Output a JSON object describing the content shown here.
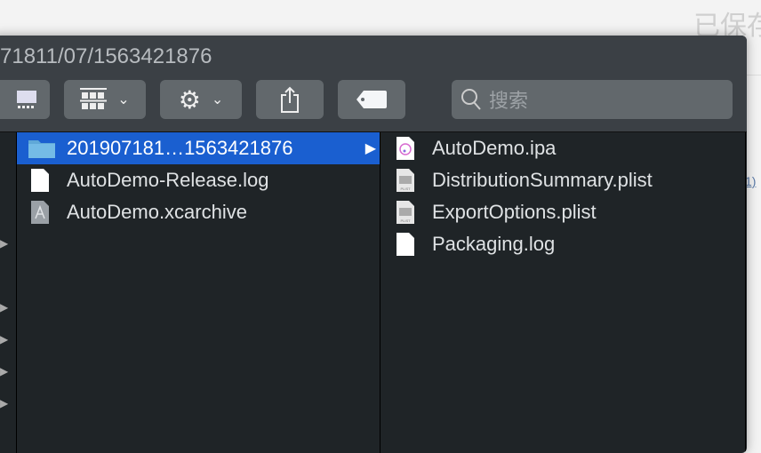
{
  "background": {
    "saved_text": "已保存",
    "link_text": "1)"
  },
  "window": {
    "title": "71811/07/1563421876"
  },
  "toolbar": {
    "search_placeholder": "搜索"
  },
  "column1": [
    {
      "name": "201907181…1563421876",
      "icon": "folder-icon",
      "selected": true
    },
    {
      "name": "AutoDemo-Release.log",
      "icon": "document-icon"
    },
    {
      "name": "AutoDemo.xcarchive",
      "icon": "xcarchive-icon"
    }
  ],
  "column2": [
    {
      "name": "AutoDemo.ipa",
      "icon": "ipa-icon"
    },
    {
      "name": "DistributionSummary.plist",
      "icon": "plist-icon"
    },
    {
      "name": "ExportOptions.plist",
      "icon": "plist-icon"
    },
    {
      "name": "Packaging.log",
      "icon": "document-icon"
    }
  ],
  "colors": {
    "selection": "#1a5fd0",
    "window": "#1f2427",
    "toolbar": "#3b4045"
  }
}
